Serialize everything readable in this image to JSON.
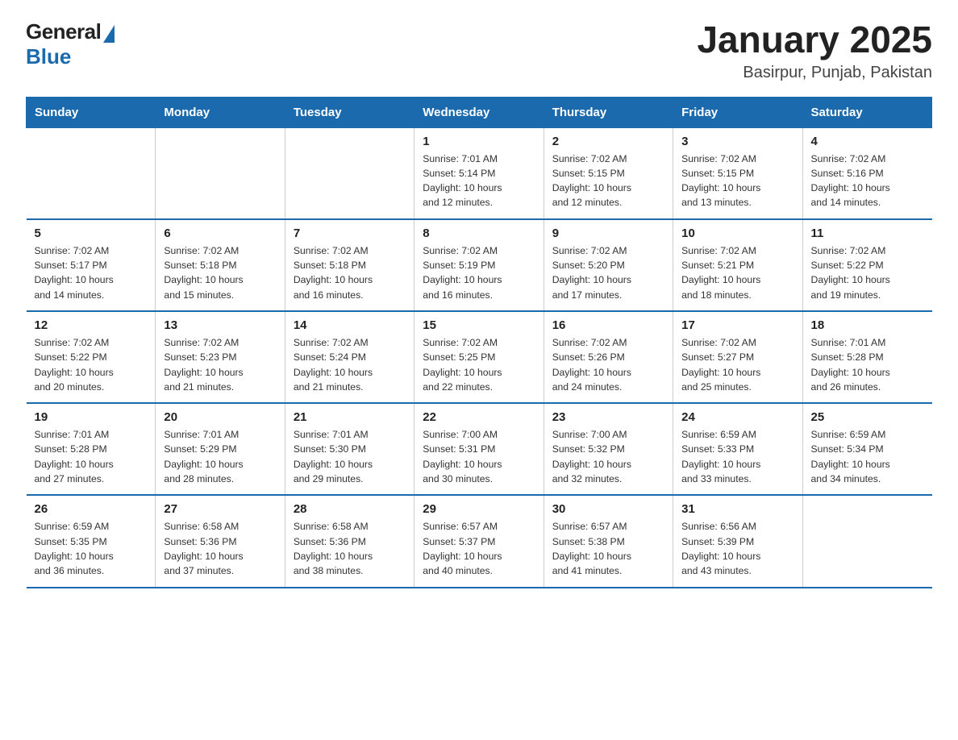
{
  "header": {
    "logo_general": "General",
    "logo_blue": "Blue",
    "month_year": "January 2025",
    "location": "Basirpur, Punjab, Pakistan"
  },
  "days_of_week": [
    "Sunday",
    "Monday",
    "Tuesday",
    "Wednesday",
    "Thursday",
    "Friday",
    "Saturday"
  ],
  "weeks": [
    [
      {
        "day": "",
        "info": ""
      },
      {
        "day": "",
        "info": ""
      },
      {
        "day": "",
        "info": ""
      },
      {
        "day": "1",
        "info": "Sunrise: 7:01 AM\nSunset: 5:14 PM\nDaylight: 10 hours\nand 12 minutes."
      },
      {
        "day": "2",
        "info": "Sunrise: 7:02 AM\nSunset: 5:15 PM\nDaylight: 10 hours\nand 12 minutes."
      },
      {
        "day": "3",
        "info": "Sunrise: 7:02 AM\nSunset: 5:15 PM\nDaylight: 10 hours\nand 13 minutes."
      },
      {
        "day": "4",
        "info": "Sunrise: 7:02 AM\nSunset: 5:16 PM\nDaylight: 10 hours\nand 14 minutes."
      }
    ],
    [
      {
        "day": "5",
        "info": "Sunrise: 7:02 AM\nSunset: 5:17 PM\nDaylight: 10 hours\nand 14 minutes."
      },
      {
        "day": "6",
        "info": "Sunrise: 7:02 AM\nSunset: 5:18 PM\nDaylight: 10 hours\nand 15 minutes."
      },
      {
        "day": "7",
        "info": "Sunrise: 7:02 AM\nSunset: 5:18 PM\nDaylight: 10 hours\nand 16 minutes."
      },
      {
        "day": "8",
        "info": "Sunrise: 7:02 AM\nSunset: 5:19 PM\nDaylight: 10 hours\nand 16 minutes."
      },
      {
        "day": "9",
        "info": "Sunrise: 7:02 AM\nSunset: 5:20 PM\nDaylight: 10 hours\nand 17 minutes."
      },
      {
        "day": "10",
        "info": "Sunrise: 7:02 AM\nSunset: 5:21 PM\nDaylight: 10 hours\nand 18 minutes."
      },
      {
        "day": "11",
        "info": "Sunrise: 7:02 AM\nSunset: 5:22 PM\nDaylight: 10 hours\nand 19 minutes."
      }
    ],
    [
      {
        "day": "12",
        "info": "Sunrise: 7:02 AM\nSunset: 5:22 PM\nDaylight: 10 hours\nand 20 minutes."
      },
      {
        "day": "13",
        "info": "Sunrise: 7:02 AM\nSunset: 5:23 PM\nDaylight: 10 hours\nand 21 minutes."
      },
      {
        "day": "14",
        "info": "Sunrise: 7:02 AM\nSunset: 5:24 PM\nDaylight: 10 hours\nand 21 minutes."
      },
      {
        "day": "15",
        "info": "Sunrise: 7:02 AM\nSunset: 5:25 PM\nDaylight: 10 hours\nand 22 minutes."
      },
      {
        "day": "16",
        "info": "Sunrise: 7:02 AM\nSunset: 5:26 PM\nDaylight: 10 hours\nand 24 minutes."
      },
      {
        "day": "17",
        "info": "Sunrise: 7:02 AM\nSunset: 5:27 PM\nDaylight: 10 hours\nand 25 minutes."
      },
      {
        "day": "18",
        "info": "Sunrise: 7:01 AM\nSunset: 5:28 PM\nDaylight: 10 hours\nand 26 minutes."
      }
    ],
    [
      {
        "day": "19",
        "info": "Sunrise: 7:01 AM\nSunset: 5:28 PM\nDaylight: 10 hours\nand 27 minutes."
      },
      {
        "day": "20",
        "info": "Sunrise: 7:01 AM\nSunset: 5:29 PM\nDaylight: 10 hours\nand 28 minutes."
      },
      {
        "day": "21",
        "info": "Sunrise: 7:01 AM\nSunset: 5:30 PM\nDaylight: 10 hours\nand 29 minutes."
      },
      {
        "day": "22",
        "info": "Sunrise: 7:00 AM\nSunset: 5:31 PM\nDaylight: 10 hours\nand 30 minutes."
      },
      {
        "day": "23",
        "info": "Sunrise: 7:00 AM\nSunset: 5:32 PM\nDaylight: 10 hours\nand 32 minutes."
      },
      {
        "day": "24",
        "info": "Sunrise: 6:59 AM\nSunset: 5:33 PM\nDaylight: 10 hours\nand 33 minutes."
      },
      {
        "day": "25",
        "info": "Sunrise: 6:59 AM\nSunset: 5:34 PM\nDaylight: 10 hours\nand 34 minutes."
      }
    ],
    [
      {
        "day": "26",
        "info": "Sunrise: 6:59 AM\nSunset: 5:35 PM\nDaylight: 10 hours\nand 36 minutes."
      },
      {
        "day": "27",
        "info": "Sunrise: 6:58 AM\nSunset: 5:36 PM\nDaylight: 10 hours\nand 37 minutes."
      },
      {
        "day": "28",
        "info": "Sunrise: 6:58 AM\nSunset: 5:36 PM\nDaylight: 10 hours\nand 38 minutes."
      },
      {
        "day": "29",
        "info": "Sunrise: 6:57 AM\nSunset: 5:37 PM\nDaylight: 10 hours\nand 40 minutes."
      },
      {
        "day": "30",
        "info": "Sunrise: 6:57 AM\nSunset: 5:38 PM\nDaylight: 10 hours\nand 41 minutes."
      },
      {
        "day": "31",
        "info": "Sunrise: 6:56 AM\nSunset: 5:39 PM\nDaylight: 10 hours\nand 43 minutes."
      },
      {
        "day": "",
        "info": ""
      }
    ]
  ]
}
